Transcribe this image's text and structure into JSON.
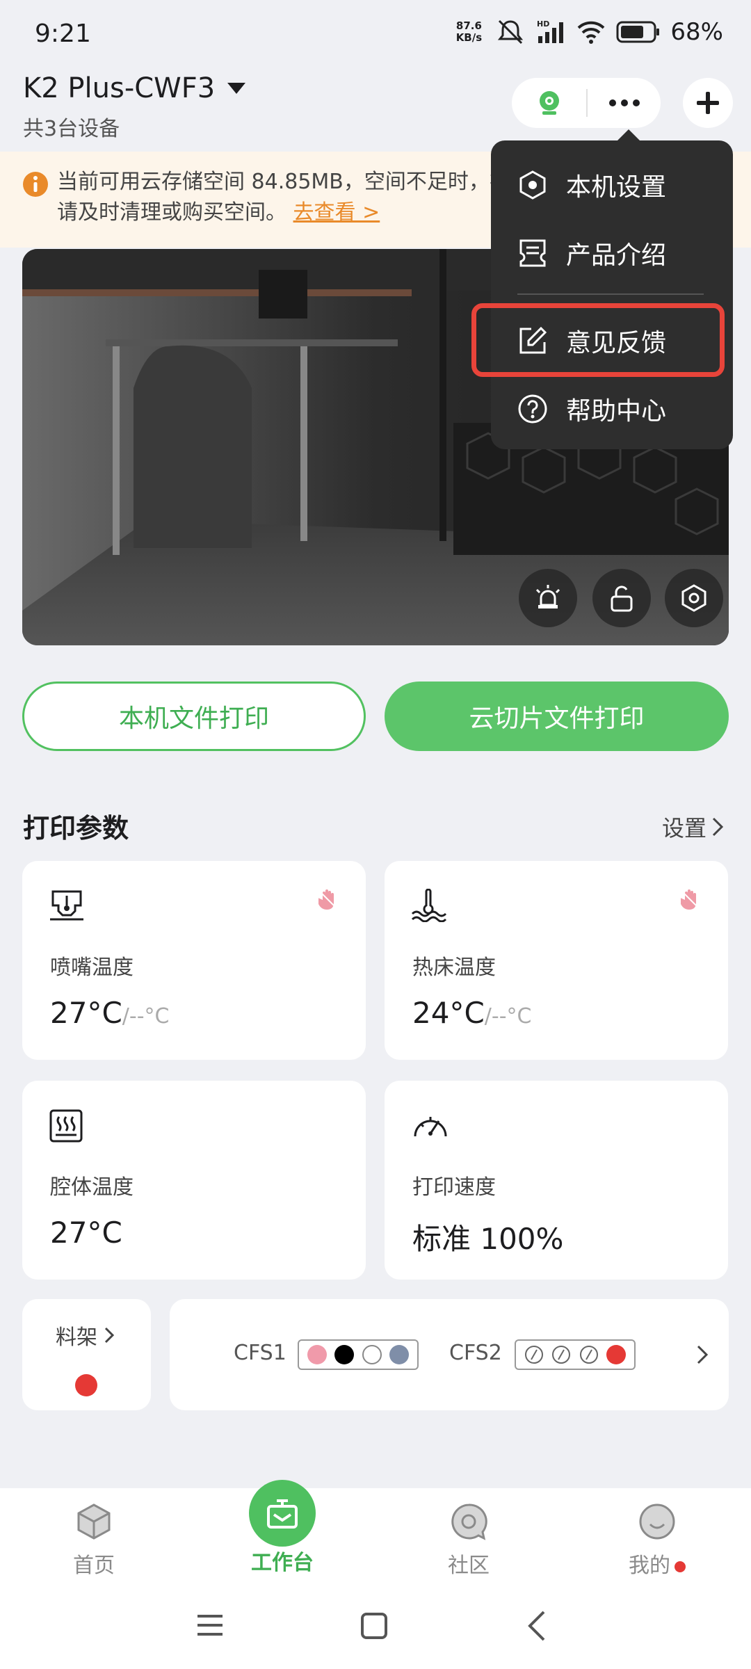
{
  "status_bar": {
    "time": "9:21",
    "net_speed_value": "87.6",
    "net_speed_unit": "KB/s",
    "network": "HD",
    "battery_pct": "68%"
  },
  "header": {
    "device_name": "K2 Plus-CWF3",
    "device_count": "共3台设备"
  },
  "notice": {
    "text": "当前可用云存储空间 84.85MB，空间不足时，视频将无法上传到云端，请及时清理或购买空间。",
    "link": "去查看 >"
  },
  "actions": {
    "local_print": "本机文件打印",
    "cloud_print": "云切片文件打印"
  },
  "params": {
    "title": "打印参数",
    "settings": "设置",
    "nozzle": {
      "label": "喷嘴温度",
      "value": "27°C",
      "target": "/--°C"
    },
    "bed": {
      "label": "热床温度",
      "value": "24°C",
      "target": "/--°C"
    },
    "chamber": {
      "label": "腔体温度",
      "value": "27°C"
    },
    "speed": {
      "label": "打印速度",
      "value": "标准 100%"
    }
  },
  "rack": {
    "label": "料架",
    "color": "#e53935"
  },
  "cfs": [
    {
      "label": "CFS1",
      "slots": [
        "#f09aaa",
        "#000000",
        "empty",
        "#7f8ea8"
      ]
    },
    {
      "label": "CFS2",
      "slots": [
        "slash",
        "slash",
        "slash",
        "#e53935"
      ]
    }
  ],
  "menu": {
    "items": [
      "本机设置",
      "产品介绍",
      "意见反馈",
      "帮助中心"
    ],
    "highlighted": "意见反馈"
  },
  "bottom_nav": {
    "items": [
      "首页",
      "工作台",
      "社区",
      "我的"
    ],
    "active": "工作台"
  },
  "colors": {
    "accent_green": "#4fc060",
    "alert_red": "#e53935",
    "notice_orange": "#e98a2a"
  }
}
